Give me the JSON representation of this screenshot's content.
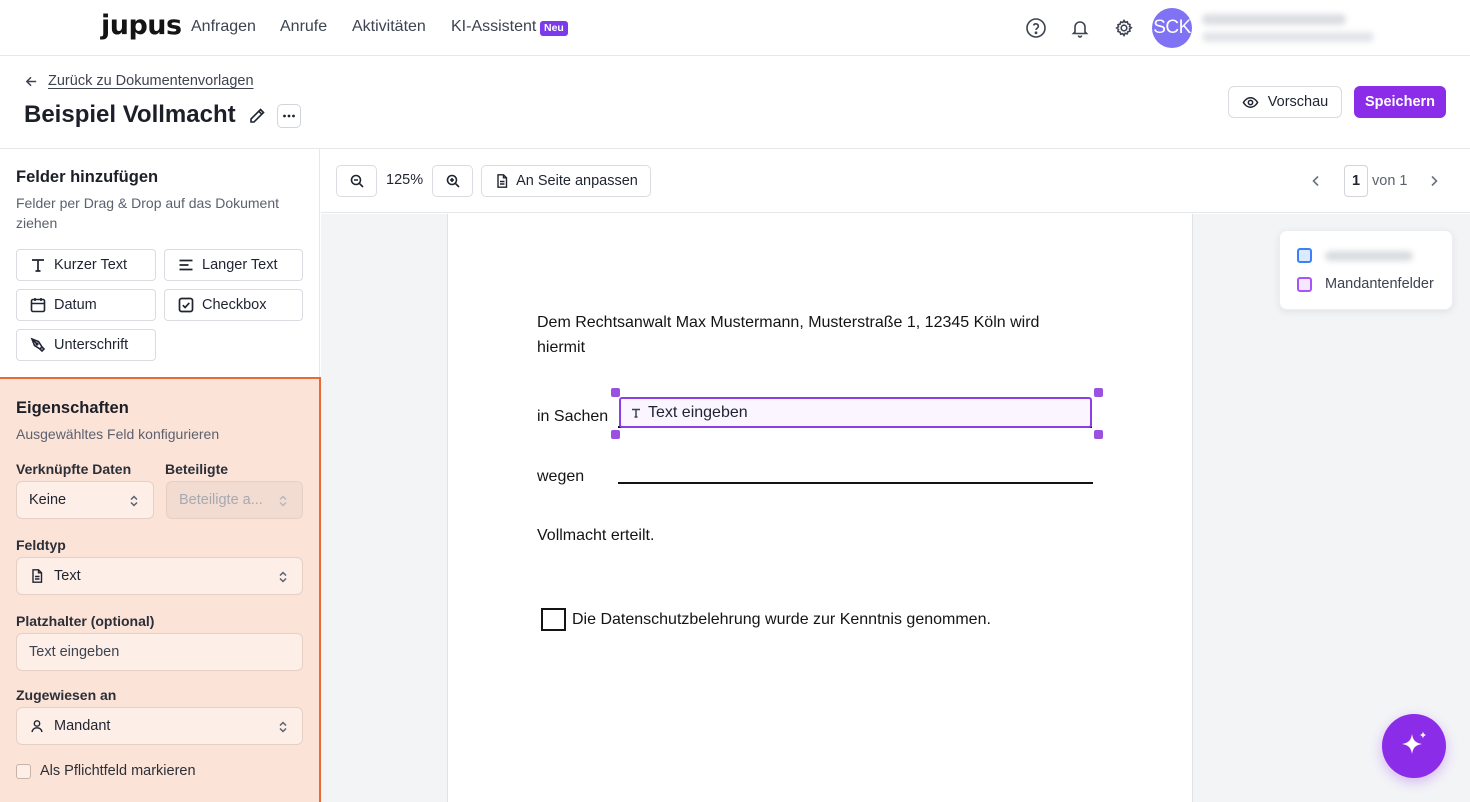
{
  "nav": {
    "logo": "jupus",
    "links": [
      "Anfragen",
      "Anrufe",
      "Aktivitäten",
      "KI-Assistent"
    ],
    "new_badge": "Neu",
    "avatar_initials": "SCK"
  },
  "header": {
    "back_label": "Zurück zu Dokumentenvorlagen",
    "title": "Beispiel Vollmacht",
    "preview_label": "Vorschau",
    "save_label": "Speichern"
  },
  "fields_panel": {
    "title": "Felder hinzufügen",
    "subtitle": "Felder per Drag & Drop auf das Dokument ziehen",
    "buttons": [
      "Kurzer Text",
      "Langer Text",
      "Datum",
      "Checkbox",
      "Unterschrift"
    ]
  },
  "properties": {
    "title": "Eigenschaften",
    "subtitle": "Ausgewähltes Feld konfigurieren",
    "linked_data_label": "Verknüpfte Daten",
    "linked_data_value": "Keine",
    "participants_label": "Beteiligte",
    "participants_value": "Beteiligte a...",
    "field_type_label": "Feldtyp",
    "field_type_value": "Text",
    "placeholder_label": "Platzhalter (optional)",
    "placeholder_value": "Text eingeben",
    "assigned_label": "Zugewiesen an",
    "assigned_value": "Mandant",
    "required_label": "Als Pflichtfeld markieren",
    "required_checked": false
  },
  "toolbar": {
    "zoom": "125%",
    "fit_label": "An Seite anpassen",
    "current_page": "1",
    "page_total": "von 1"
  },
  "document": {
    "line1": "Dem Rechtsanwalt Max Mustermann, Musterstraße 1, 12345 Köln wird",
    "line2": "hiermit",
    "in_sachen": "in Sachen",
    "field_text": "Text eingeben",
    "wegen": "wegen",
    "vollmacht": "Vollmacht erteilt.",
    "checkbox_text": "Die Datenschutzbelehrung wurde zur Kenntnis genommen."
  },
  "legend": {
    "items": [
      "",
      "Mandantenfelder"
    ],
    "colors": [
      "#3b82f6",
      "#a855f7"
    ]
  },
  "colors": {
    "accent": "#8b2ce8",
    "selection": "#9b51e0",
    "properties_bg": "#fce3d8",
    "properties_border": "#e86a34"
  }
}
